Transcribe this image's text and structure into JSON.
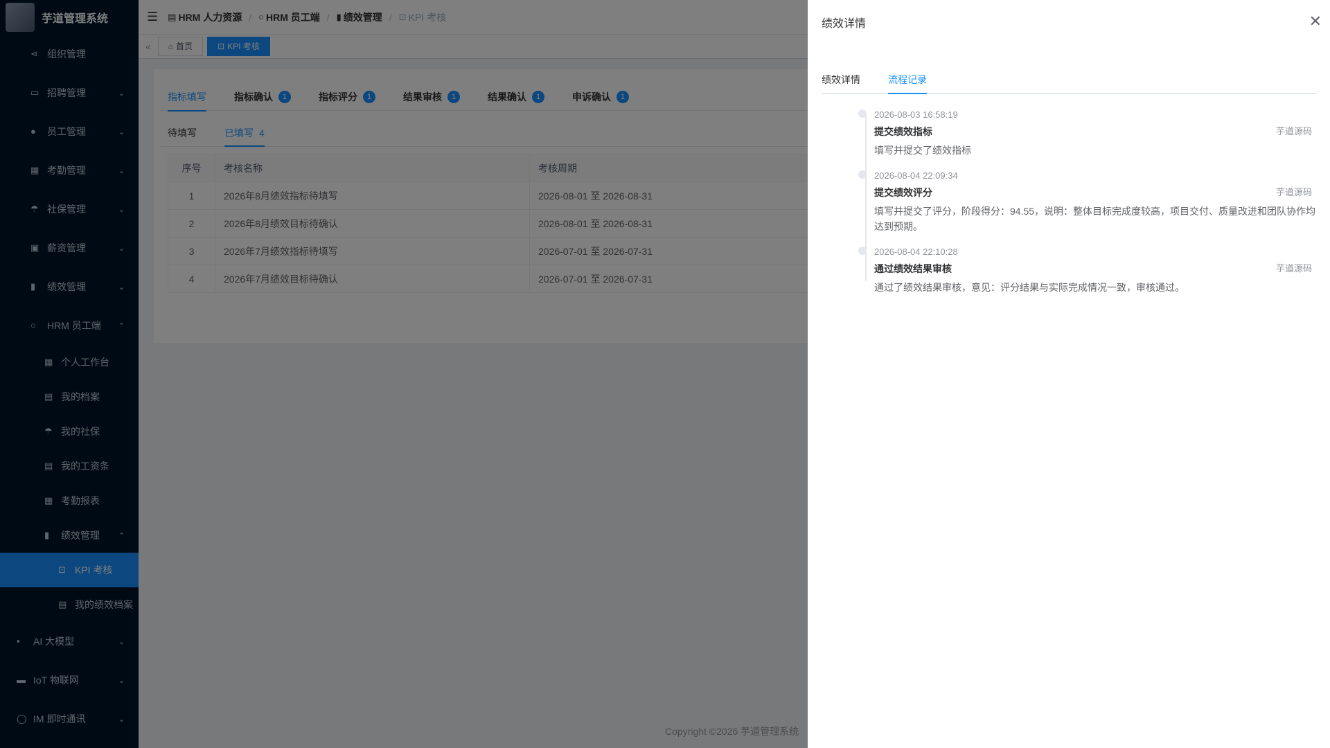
{
  "app": {
    "title": "芋道管理系统"
  },
  "sidebar": {
    "items": [
      {
        "label": "组织管理",
        "icon": "share-icon"
      },
      {
        "label": "招聘管理",
        "icon": "briefcase-icon"
      },
      {
        "label": "员工管理",
        "icon": "user-icon"
      },
      {
        "label": "考勤管理",
        "icon": "calendar-icon"
      },
      {
        "label": "社保管理",
        "icon": "umbrella-icon"
      },
      {
        "label": "薪资管理",
        "icon": "money-icon"
      },
      {
        "label": "绩效管理",
        "icon": "bar-chart-icon"
      },
      {
        "label": "HRM 员工端",
        "icon": "user-outline-icon"
      }
    ],
    "hrm_sub": [
      {
        "label": "个人工作台"
      },
      {
        "label": "我的档案"
      },
      {
        "label": "我的社保"
      },
      {
        "label": "我的工资条"
      },
      {
        "label": "考勤报表"
      },
      {
        "label": "绩效管理"
      }
    ],
    "perf_sub": [
      {
        "label": "KPI 考核"
      },
      {
        "label": "我的绩效档案"
      }
    ],
    "bottom": [
      {
        "label": "AI 大模型"
      },
      {
        "label": "IoT 物联网"
      },
      {
        "label": "IM 即时通讯"
      }
    ]
  },
  "breadcrumb": [
    "HRM 人力资源",
    "HRM 员工端",
    "绩效管理",
    "KPI 考核"
  ],
  "tags": {
    "home": "首页",
    "current": "KPI 考核"
  },
  "main": {
    "tabs": [
      {
        "label": "指标填写",
        "badge": ""
      },
      {
        "label": "指标确认",
        "badge": "1"
      },
      {
        "label": "指标评分",
        "badge": "1"
      },
      {
        "label": "结果审核",
        "badge": "1"
      },
      {
        "label": "结果确认",
        "badge": "1"
      },
      {
        "label": "申诉确认",
        "badge": "1"
      }
    ],
    "subtabs": [
      {
        "label": "待填写",
        "count": ""
      },
      {
        "label": "已填写",
        "count": "4"
      }
    ],
    "table": {
      "headers": [
        "序号",
        "考核名称",
        "考核周期"
      ],
      "rows": [
        [
          "1",
          "2026年8月绩效指标待填写",
          "2026-08-01 至 2026-08-31"
        ],
        [
          "2",
          "2026年8月绩效目标待确认",
          "2026-08-01 至 2026-08-31"
        ],
        [
          "3",
          "2026年7月绩效指标待填写",
          "2026-07-01 至 2026-07-31"
        ],
        [
          "4",
          "2026年7月绩效目标待确认",
          "2026-07-01 至 2026-07-31"
        ]
      ]
    }
  },
  "footer": "Copyright ©2026 芋道管理系统",
  "drawer": {
    "title": "绩效详情",
    "tabs": [
      "绩效详情",
      "流程记录"
    ],
    "timeline": [
      {
        "time": "2026-08-03 16:58:19",
        "title": "提交绩效指标",
        "user": "芋道源码",
        "desc": "填写并提交了绩效指标"
      },
      {
        "time": "2026-08-04 22:09:34",
        "title": "提交绩效评分",
        "user": "芋道源码",
        "desc": "填写并提交了评分，阶段得分：94.55，说明：整体目标完成度较高，项目交付、质量改进和团队协作均达到预期。"
      },
      {
        "time": "2026-08-04 22:10:28",
        "title": "通过绩效结果审核",
        "user": "芋道源码",
        "desc": "通过了绩效结果审核，意见：评分结果与实际完成情况一致，审核通过。"
      }
    ]
  },
  "colors": {
    "primary": "#1890ff",
    "sidebar_bg": "#001529"
  }
}
